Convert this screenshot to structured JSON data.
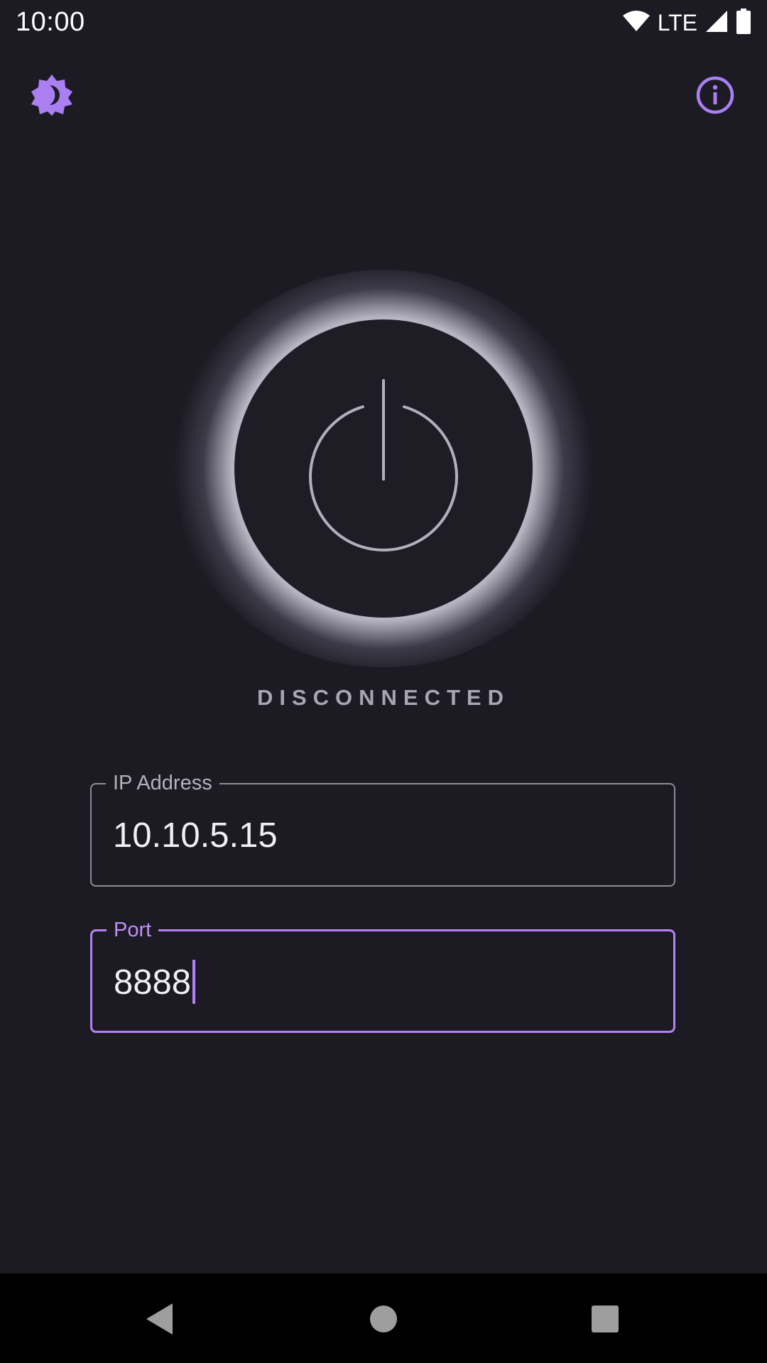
{
  "status_bar": {
    "time": "10:00",
    "network": "LTE",
    "icons": [
      "wifi-icon",
      "signal-icon",
      "battery-icon"
    ]
  },
  "top_bar": {
    "left_icon": "theme-toggle-icon",
    "right_icon": "info-icon"
  },
  "main": {
    "power_icon": "power-icon",
    "status_text": "DISCONNECTED",
    "ip_field": {
      "label": "IP Address",
      "value": "10.10.5.15"
    },
    "port_field": {
      "label": "Port",
      "value": "8888",
      "focused": true
    }
  },
  "nav_bar": {
    "buttons": [
      "back-icon",
      "home-icon",
      "recents-icon"
    ]
  },
  "colors": {
    "background": "#1c1b23",
    "accent": "#b582f5",
    "icon_accent": "#a97ff2",
    "muted_text": "#a8a4b0"
  }
}
